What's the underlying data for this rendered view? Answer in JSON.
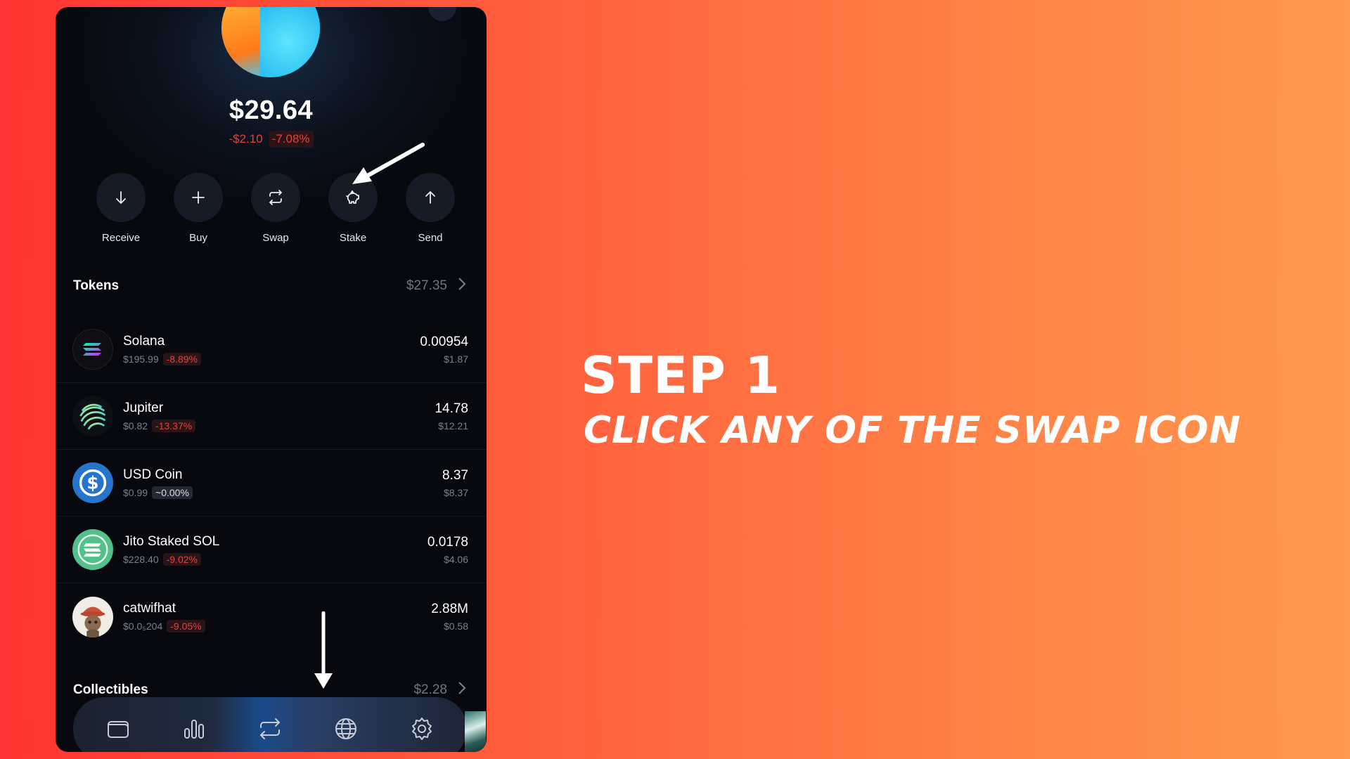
{
  "wallet": {
    "balance": "$29.64",
    "change_abs": "-$2.10",
    "change_pct": "-7.08%"
  },
  "actions": [
    {
      "label": "Receive",
      "icon": "arrow-down-icon"
    },
    {
      "label": "Buy",
      "icon": "plus-icon"
    },
    {
      "label": "Swap",
      "icon": "swap-icon"
    },
    {
      "label": "Stake",
      "icon": "piggy-bank-icon"
    },
    {
      "label": "Send",
      "icon": "arrow-up-icon"
    }
  ],
  "tokens_section": {
    "title": "Tokens",
    "total": "$27.35"
  },
  "tokens": [
    {
      "name": "Solana",
      "price": "$195.99",
      "pct": "-8.89%",
      "amount": "0.00954",
      "value": "$1.87"
    },
    {
      "name": "Jupiter",
      "price": "$0.82",
      "pct": "-13.37%",
      "amount": "14.78",
      "value": "$12.21"
    },
    {
      "name": "USD Coin",
      "price": "$0.99",
      "pct": "~0.00%",
      "amount": "8.37",
      "value": "$8.37"
    },
    {
      "name": "Jito Staked SOL",
      "price": "$228.40",
      "pct": "-9.02%",
      "amount": "0.0178",
      "value": "$4.06"
    },
    {
      "name": "catwifhat",
      "price": "$0.0₅204",
      "pct": "-9.05%",
      "amount": "2.88M",
      "value": "$0.58"
    }
  ],
  "collectibles_section": {
    "title": "Collectibles",
    "total": "$2.28"
  },
  "nav": [
    {
      "icon": "wallet-icon"
    },
    {
      "icon": "chart-bars-icon"
    },
    {
      "icon": "swap-icon"
    },
    {
      "icon": "globe-icon"
    },
    {
      "icon": "gear-icon"
    }
  ],
  "instructions": {
    "step": "STEP 1",
    "text": "CLICK ANY OF THE SWAP ICON"
  },
  "colors": {
    "negative": "#e0443d",
    "background_start": "#ff3434",
    "background_end": "#ff9a4f"
  }
}
